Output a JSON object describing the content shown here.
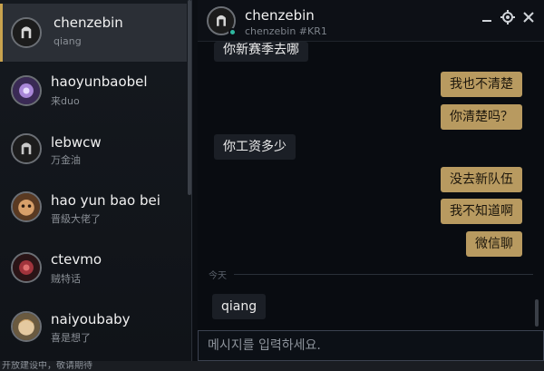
{
  "contacts": [
    {
      "name": "chenzebin",
      "status": "qiang",
      "active": true
    },
    {
      "name": "haoyunbaobel",
      "status": "来duo"
    },
    {
      "name": "lebwcw",
      "status": "万金油"
    },
    {
      "name": "hao yun bao bei",
      "status": "晋級大佬了"
    },
    {
      "name": "ctevmo",
      "status": "贼特话"
    },
    {
      "name": "naiyoubaby",
      "status": "喜是想了"
    }
  ],
  "chat": {
    "header": {
      "name": "chenzebin",
      "subtitle": "chenzebin #KR1"
    },
    "messages": [
      {
        "dir": "in",
        "text": "你新赛季去哪"
      },
      {
        "dir": "out",
        "text": "我也不清楚"
      },
      {
        "dir": "out",
        "text": "你清楚吗？"
      },
      {
        "dir": "in",
        "text": "你工资多少"
      },
      {
        "dir": "out",
        "text": "没去新队伍"
      },
      {
        "dir": "out",
        "text": "我不知道啊"
      },
      {
        "dir": "out",
        "text": "微信聊"
      },
      {
        "dir": "in",
        "text": "qiang"
      }
    ],
    "date_separator": "今天",
    "input_placeholder": "메시지를 입력하세요."
  },
  "bottom_bar": {
    "left_text": "开放建设中，敬请期待"
  },
  "icons": {
    "minimize": "minimize-icon",
    "settings": "gear-icon",
    "close": "close-icon"
  },
  "colors": {
    "accent": "#c8a24e",
    "outgoing_bubble": "#b89a60",
    "incoming_bubble": "#1b1f26",
    "online": "#2fb8a0"
  }
}
